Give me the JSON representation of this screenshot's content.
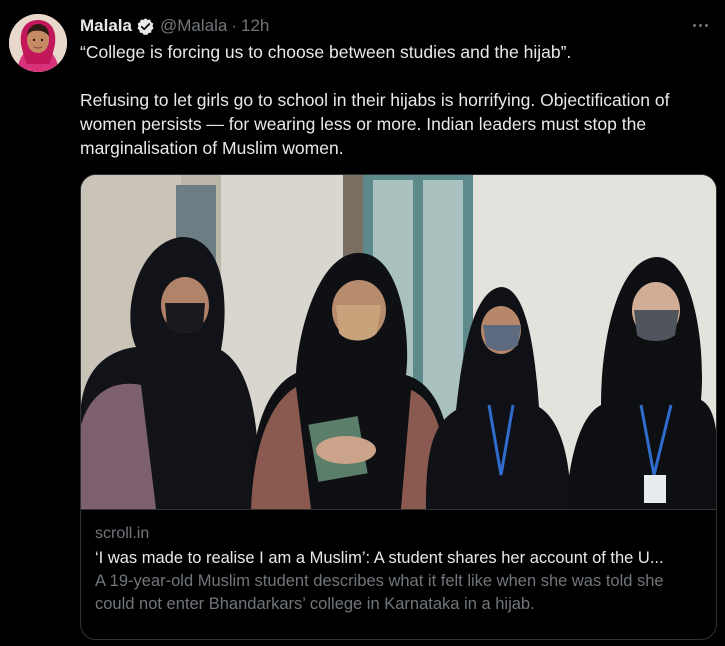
{
  "tweet": {
    "author": {
      "display_name": "Malala",
      "verified": true,
      "handle": "@Malala",
      "separator": "·",
      "timestamp": "12h"
    },
    "text_paragraphs": [
      "“College is forcing us to choose between studies and the hijab”.",
      "Refusing to let girls go to school in their hijabs is horrifying. Objectification of women persists — for wearing less or more. Indian leaders must stop the marginalisation of Muslim women."
    ],
    "more_icon": "more-horizontal-icon",
    "verified_icon": "verified-badge-icon",
    "colors": {
      "background": "#000000",
      "text": "#e7e9ea",
      "secondary": "#71767b",
      "border": "#2f3336",
      "verified_badge": "#e7e9ea"
    }
  },
  "link_card": {
    "domain": "scroll.in",
    "title": "‘I was made to realise I am a Muslim’: A student shares her account of the U...",
    "description": "A 19-year-old Muslim student describes what it felt like when she was told she could not enter Bhandarkars’ college in Karnataka in a hijab."
  }
}
